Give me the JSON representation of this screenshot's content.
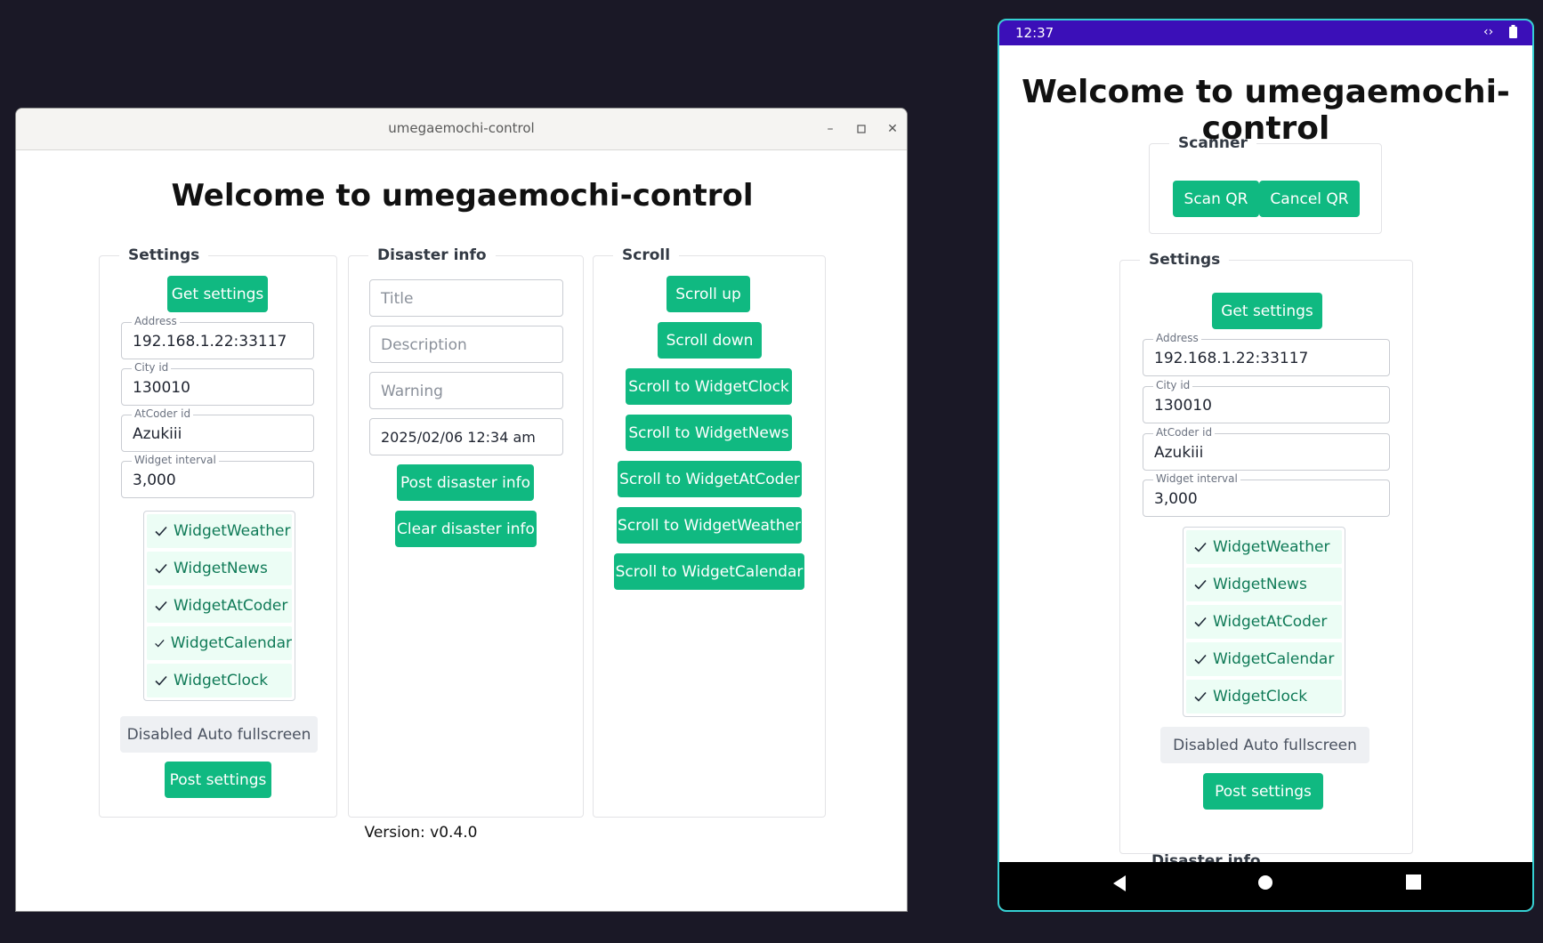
{
  "desktop": {
    "window_title": "umegaemochi-control",
    "heading": "Welcome to umegaemochi-control",
    "settings": {
      "legend": "Settings",
      "get_button": "Get settings",
      "fields": [
        {
          "label": "Address",
          "value": "192.168.1.22:33117"
        },
        {
          "label": "City id",
          "value": "130010"
        },
        {
          "label": "AtCoder id",
          "value": "Azukiii"
        },
        {
          "label": "Widget interval",
          "value": "3,000"
        }
      ],
      "widgets": [
        "WidgetWeather",
        "WidgetNews",
        "WidgetAtCoder",
        "WidgetCalendar",
        "WidgetClock"
      ],
      "fullscreen_button": "Disabled Auto fullscreen",
      "post_button": "Post settings"
    },
    "disaster": {
      "legend": "Disaster info",
      "title_placeholder": "Title",
      "description_placeholder": "Description",
      "warning_placeholder": "Warning",
      "datetime_value": "2025/02/06 12:34 am",
      "post_button": "Post disaster info",
      "clear_button": "Clear disaster info"
    },
    "scroll": {
      "legend": "Scroll",
      "buttons": [
        "Scroll up",
        "Scroll down",
        "Scroll to WidgetClock",
        "Scroll to WidgetNews",
        "Scroll to WidgetAtCoder",
        "Scroll to WidgetWeather",
        "Scroll to WidgetCalendar"
      ]
    },
    "version": "Version: v0.4.0"
  },
  "phone": {
    "status_time": "12:37",
    "heading": "Welcome to umegaemochi-control",
    "scanner": {
      "legend": "Scanner",
      "scan_button": "Scan QR",
      "cancel_button": "Cancel QR"
    },
    "settings": {
      "legend": "Settings",
      "get_button": "Get settings",
      "fields": [
        {
          "label": "Address",
          "value": "192.168.1.22:33117"
        },
        {
          "label": "City id",
          "value": "130010"
        },
        {
          "label": "AtCoder id",
          "value": "Azukiii"
        },
        {
          "label": "Widget interval",
          "value": "3,000"
        }
      ],
      "widgets": [
        "WidgetWeather",
        "WidgetNews",
        "WidgetAtCoder",
        "WidgetCalendar",
        "WidgetClock"
      ],
      "fullscreen_button": "Disabled Auto fullscreen",
      "post_button": "Post settings"
    },
    "next_section_legend": "Disaster info"
  },
  "colors": {
    "accent": "#10b981",
    "checked_bg": "#ecfdf5",
    "checked_text": "#0f7a57",
    "status_bar": "#3b0fb8",
    "phone_frame": "#35d0d3"
  },
  "icons": {
    "check": "check-icon",
    "minimize": "minimize-icon",
    "maximize": "maximize-icon",
    "close": "close-icon"
  }
}
